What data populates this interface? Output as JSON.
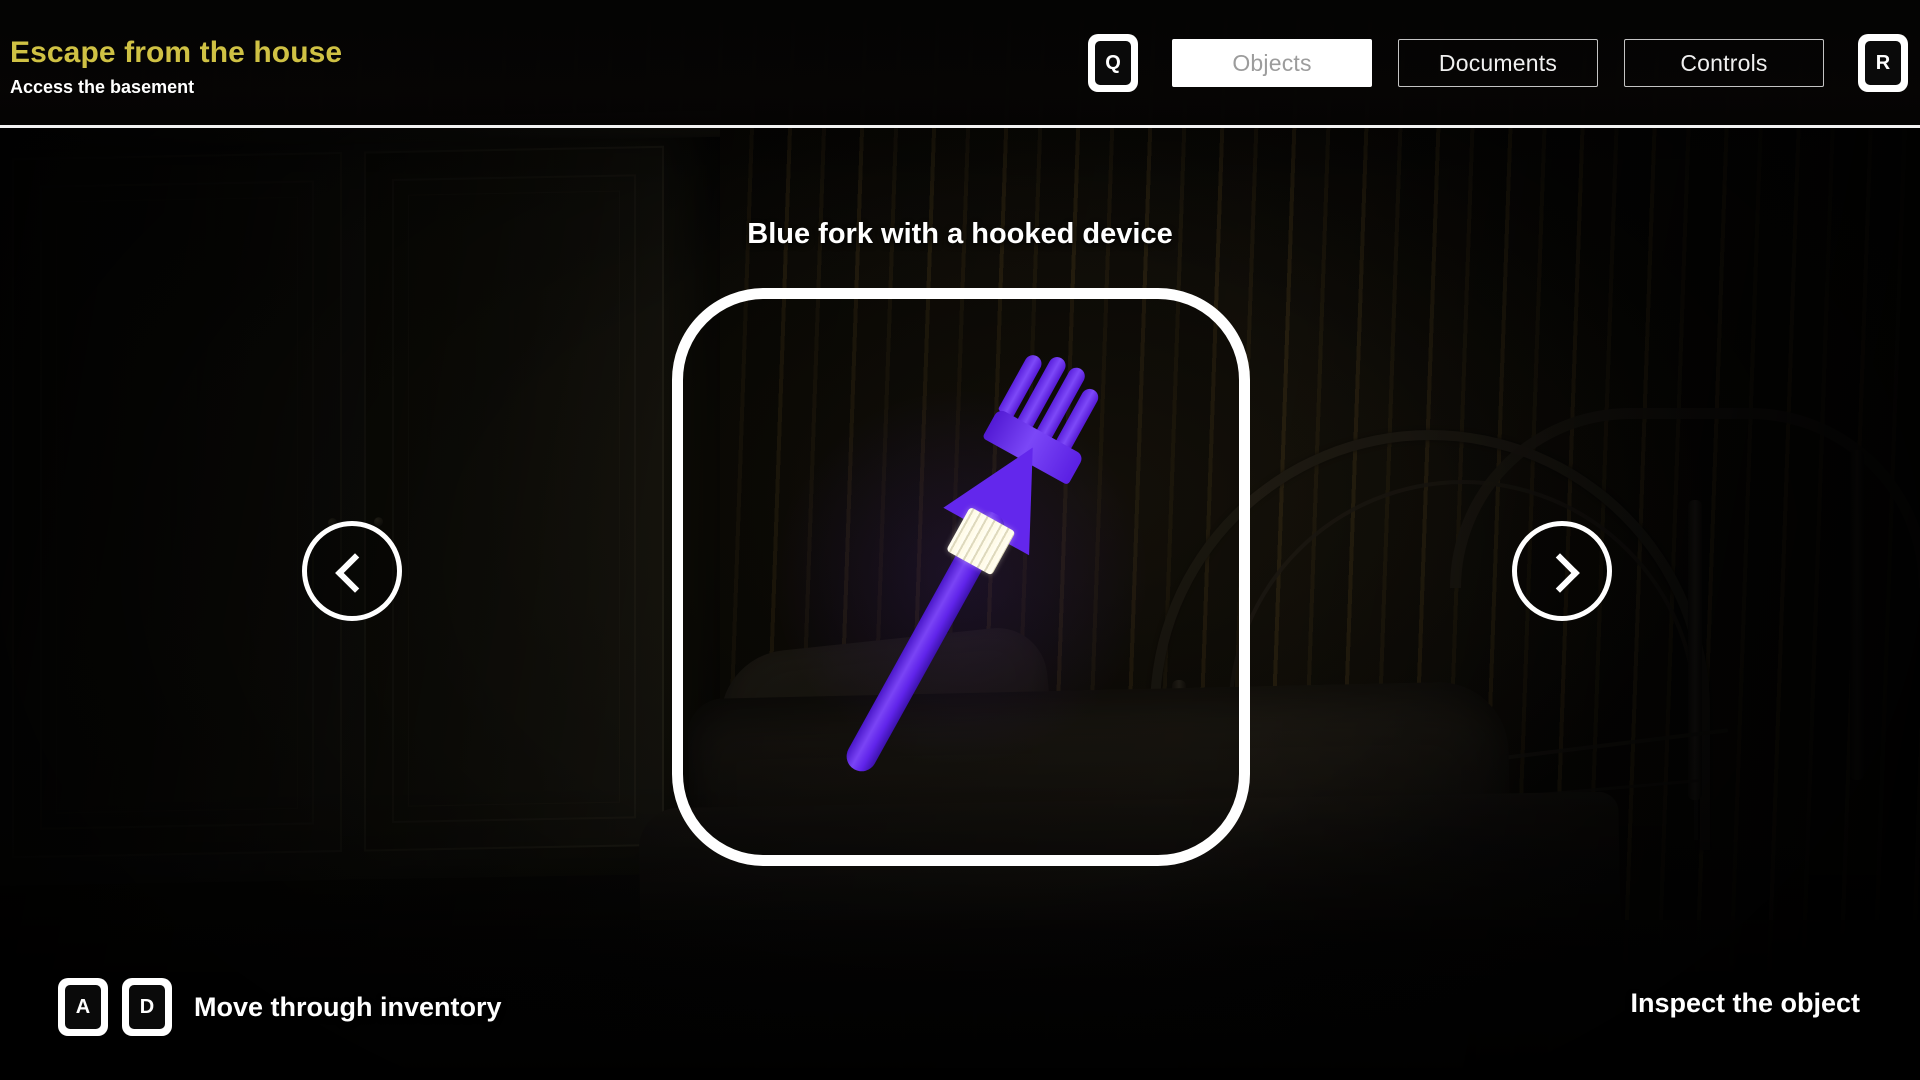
{
  "header": {
    "game_title": "Escape from the house",
    "objective": "Access the basement",
    "inventory_key": "Q",
    "reload_key": "R",
    "tabs": [
      {
        "label": "Objects",
        "active": true
      },
      {
        "label": "Documents",
        "active": false
      },
      {
        "label": "Controls",
        "active": false
      }
    ]
  },
  "inventory": {
    "object_name": "Blue fork with a hooked device",
    "prev_icon": "chevron-left-icon",
    "next_icon": "chevron-right-icon",
    "object_color": "#6327ec",
    "band_color": "#fffdf0",
    "frame_color": "#ffffff"
  },
  "hints": {
    "move_keys": [
      "A",
      "D"
    ],
    "move_label": "Move through inventory",
    "inspect_label": "Inspect the object"
  },
  "theme": {
    "title_color": "#cfc144",
    "text_color": "#ffffff",
    "active_tab_text": "#9c9c9c",
    "background": "#060504"
  }
}
